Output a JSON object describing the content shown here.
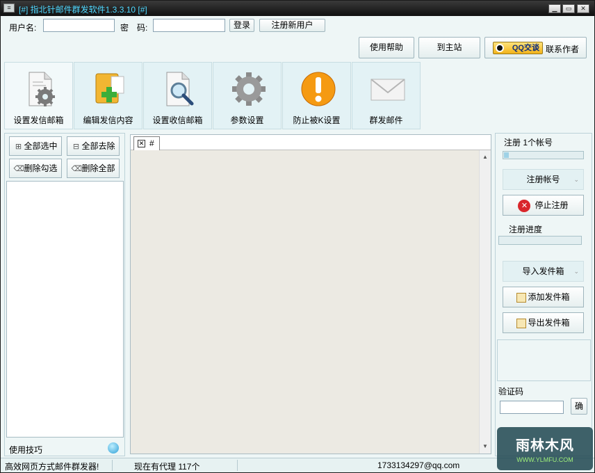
{
  "window": {
    "title": "[#] 指北针邮件群发软件1.3.3.10 [#]",
    "sys_icon": "≡",
    "min_label": "▁",
    "max_label": "▭",
    "close_label": "✕"
  },
  "login": {
    "username_label": "用户名:",
    "username_value": "",
    "password_label": "密　码:",
    "password_value": "",
    "login_button": "登录",
    "register_button": "注册新用户"
  },
  "top_actions": {
    "help_button": "使用帮助",
    "home_button": "到主站",
    "qq_badge": "QQ交谈",
    "contact_label": "联系作者"
  },
  "tabs": [
    {
      "label": "设置发信邮箱",
      "icon": "mail-settings-icon"
    },
    {
      "label": "编辑发信内容",
      "icon": "edit-content-icon"
    },
    {
      "label": "设置收信邮箱",
      "icon": "search-recipients-icon"
    },
    {
      "label": "参数设置",
      "icon": "gear-icon"
    },
    {
      "label": "防止被K设置",
      "icon": "warning-icon"
    },
    {
      "label": "群发邮件",
      "icon": "envelope-icon"
    }
  ],
  "left_panel": {
    "select_all": "全部选中",
    "deselect_all": "全部去除",
    "delete_checked": "删除勾选",
    "delete_all": "删除全部",
    "tips_label": "使用技巧"
  },
  "editor": {
    "tab_name": "#",
    "tab_close": "✕"
  },
  "right_panel": {
    "register_count_text": "注册 1个帐号",
    "register_progress_fraction": 0.06,
    "register_account_button": "注册帐号",
    "stop_register_button": "停止注册",
    "stop_icon_glyph": "✕",
    "register_progress_label": "注册进度",
    "register_progress2_fraction": 0.0,
    "import_outbox_button": "导入发件箱",
    "add_outbox_button": "添加发件箱",
    "export_outbox_button": "导出发件箱",
    "captcha_label": "验证码",
    "captcha_value": "",
    "confirm_button": "确"
  },
  "statusbar": {
    "slogan": "高效网页方式邮件群发器!",
    "proxy_text": "现在有代理 117个",
    "email": "1733134297@qq.com"
  },
  "watermark": {
    "main": "雨林木风",
    "sub": "WWW.YLMFU.COM"
  },
  "colors": {
    "title_text": "#4fd8ff",
    "window_bg": "#eef6f6",
    "tab_bg": "#e3f2f5",
    "editor_bg": "#eceae3",
    "stop_red": "#d9262b"
  }
}
